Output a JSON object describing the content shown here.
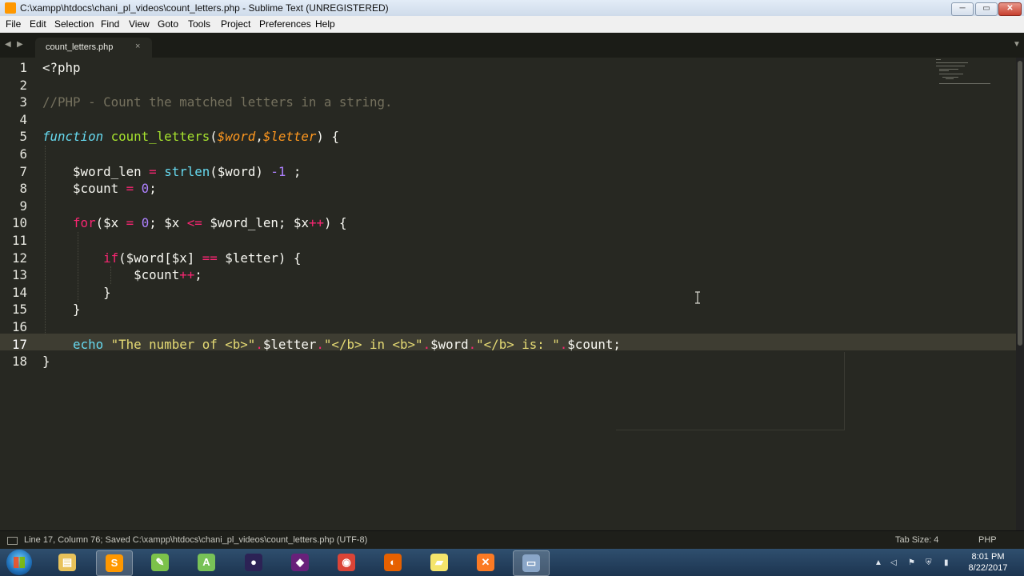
{
  "window": {
    "title": "C:\\xampp\\htdocs\\chani_pl_videos\\count_letters.php - Sublime Text (UNREGISTERED)",
    "min_label": "─",
    "max_label": "▭",
    "close_label": "✕"
  },
  "menu": [
    "File",
    "Edit",
    "Selection",
    "Find",
    "View",
    "Goto",
    "Tools",
    "Project",
    "Preferences",
    "Help"
  ],
  "tabs": {
    "active": "count_letters.php",
    "close_glyph": "×",
    "back_glyph": "◀",
    "fwd_glyph": "▶",
    "dropdown_glyph": "▼"
  },
  "editor": {
    "line_numbers": [
      "1",
      "2",
      "3",
      "4",
      "5",
      "6",
      "7",
      "8",
      "9",
      "10",
      "11",
      "12",
      "13",
      "14",
      "15",
      "16",
      "17",
      "18"
    ],
    "current_line": "17",
    "code": {
      "l1": "<?php",
      "l3": "//PHP - Count the matched letters in a string.",
      "l5": {
        "kw": "function",
        "name": "count_letters",
        "open": "(",
        "p1": "$word",
        "comma": ",",
        "p2": "$letter",
        "close": ") {"
      },
      "l7": {
        "var": "$word_len",
        "eq": "=",
        "fn": "strlen",
        "args": "($word)",
        "minus": "-1",
        "end": ";"
      },
      "l8": {
        "var": "$count",
        "eq": "=",
        "num": "0",
        "end": ";"
      },
      "l10": {
        "kw": "for",
        "a": "($x",
        "eq": "=",
        "zero": "0",
        "b": "; $x",
        "le": "<=",
        "c": "$word_len; $x",
        "inc": "++",
        "d": ") {"
      },
      "l12": {
        "kw": "if",
        "a": "($word[$x]",
        "eqeq": "==",
        "b": "$letter) {"
      },
      "l13": {
        "var": "$count",
        "inc": "++",
        "end": ";"
      },
      "l14": "}",
      "l15": "}",
      "l17": {
        "kw": "echo",
        "s1": "\"The number of <b>\"",
        "dot1": ".",
        "v1": "$letter",
        "dot2": ".",
        "s2": "\"</b> in <b>\"",
        "dot3": ".",
        "v2": "$word",
        "dot4": ".",
        "s3": "\"</b> is: \"",
        "dot5": ".",
        "v3": "$count;"
      },
      "l18": "}"
    },
    "colors": {
      "background": "#272822",
      "comment": "#75715e",
      "keyword": "#66d9ef",
      "function_name": "#a6e22e",
      "parameter": "#fd971f",
      "operator": "#f92672",
      "number": "#ae81ff",
      "string": "#e6db74"
    }
  },
  "status": {
    "left": "Line 17, Column 76; Saved C:\\xampp\\htdocs\\chani_pl_videos\\count_letters.php (UTF-8)",
    "tab_size": "Tab Size: 4",
    "syntax": "PHP"
  },
  "taskbar": {
    "apps": [
      {
        "name": "file-explorer",
        "glyph": "▤",
        "color": "#e8c25a",
        "active": false
      },
      {
        "name": "sublime-text",
        "glyph": "S",
        "color": "#ff9800",
        "active": true
      },
      {
        "name": "notepad-plus-plus",
        "glyph": "✎",
        "color": "#7cc24a",
        "active": false
      },
      {
        "name": "android-studio",
        "glyph": "A",
        "color": "#78c257",
        "active": false
      },
      {
        "name": "eclipse",
        "glyph": "●",
        "color": "#2c2255",
        "active": false
      },
      {
        "name": "visual-studio",
        "glyph": "◆",
        "color": "#68217a",
        "active": false
      },
      {
        "name": "chrome",
        "glyph": "◉",
        "color": "#db4437",
        "active": false
      },
      {
        "name": "firefox",
        "glyph": "◐",
        "color": "#e66000",
        "active": false
      },
      {
        "name": "sticky-notes",
        "glyph": "▰",
        "color": "#f5e56b",
        "active": false
      },
      {
        "name": "xampp",
        "glyph": "✕",
        "color": "#fb7a24",
        "active": false
      },
      {
        "name": "window-app",
        "glyph": "▭",
        "color": "#8aa6c8",
        "active": true
      }
    ],
    "tray_icons": [
      "▲",
      "◁",
      "⚑",
      "⛨",
      "▮"
    ],
    "time": "8:01 PM",
    "date": "8/22/2017"
  }
}
